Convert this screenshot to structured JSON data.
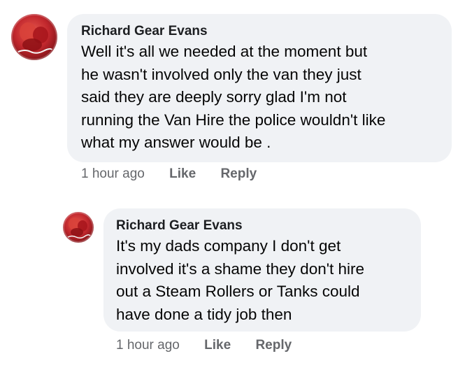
{
  "comments": [
    {
      "author": "Richard Gear Evans",
      "lines": [
        "Well it's all we needed at the moment but",
        "he wasn't involved only the van they just",
        "said they are deeply sorry glad I'm not",
        "running the Van Hire the police wouldn't like",
        "what my answer would be ."
      ],
      "time": "1 hour ago",
      "like_label": "Like",
      "reply_label": "Reply",
      "avatar_icon": "profile-photo-icon"
    },
    {
      "author": "Richard Gear Evans",
      "lines": [
        "It's my dads company I don't get",
        "involved it's a shame they don't hire",
        "out a Steam Rollers or Tanks could",
        "have done a tidy job then"
      ],
      "time": "1 hour ago",
      "like_label": "Like",
      "reply_label": "Reply",
      "avatar_icon": "profile-photo-icon"
    }
  ],
  "colors": {
    "bubble": "#f0f2f5",
    "author": "#1c1e21",
    "text": "#050505",
    "meta": "#65676b",
    "avatar": "#c1272d"
  }
}
